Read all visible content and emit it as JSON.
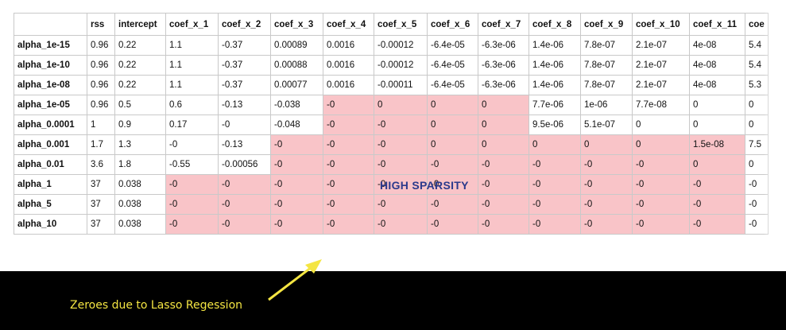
{
  "table": {
    "columns": [
      "",
      "rss",
      "intercept",
      "coef_x_1",
      "coef_x_2",
      "coef_x_3",
      "coef_x_4",
      "coef_x_5",
      "coef_x_6",
      "coef_x_7",
      "coef_x_8",
      "coef_x_9",
      "coef_x_10",
      "coef_x_11",
      "coe"
    ],
    "rows": [
      {
        "label": "alpha_1e-15",
        "cells": [
          "0.96",
          "0.22",
          "1.1",
          "-0.37",
          "0.00089",
          "0.0016",
          "-0.00012",
          "-6.4e-05",
          "-6.3e-06",
          "1.4e-06",
          "7.8e-07",
          "2.1e-07",
          "4e-08",
          "5.4"
        ]
      },
      {
        "label": "alpha_1e-10",
        "cells": [
          "0.96",
          "0.22",
          "1.1",
          "-0.37",
          "0.00088",
          "0.0016",
          "-0.00012",
          "-6.4e-05",
          "-6.3e-06",
          "1.4e-06",
          "7.8e-07",
          "2.1e-07",
          "4e-08",
          "5.4"
        ]
      },
      {
        "label": "alpha_1e-08",
        "cells": [
          "0.96",
          "0.22",
          "1.1",
          "-0.37",
          "0.00077",
          "0.0016",
          "-0.00011",
          "-6.4e-05",
          "-6.3e-06",
          "1.4e-06",
          "7.8e-07",
          "2.1e-07",
          "4e-08",
          "5.3"
        ]
      },
      {
        "label": "alpha_1e-05",
        "cells": [
          "0.96",
          "0.5",
          "0.6",
          "-0.13",
          "-0.038",
          "-0",
          "0",
          "0",
          "0",
          "7.7e-06",
          "1e-06",
          "7.7e-08",
          "0",
          "0"
        ]
      },
      {
        "label": "alpha_0.0001",
        "cells": [
          "1",
          "0.9",
          "0.17",
          "-0",
          "-0.048",
          "-0",
          "-0",
          "0",
          "0",
          "9.5e-06",
          "5.1e-07",
          "0",
          "0",
          "0"
        ]
      },
      {
        "label": "alpha_0.001",
        "cells": [
          "1.7",
          "1.3",
          "-0",
          "-0.13",
          "-0",
          "-0",
          "-0",
          "0",
          "0",
          "0",
          "0",
          "0",
          "1.5e-08",
          "7.5"
        ]
      },
      {
        "label": "alpha_0.01",
        "cells": [
          "3.6",
          "1.8",
          "-0.55",
          "-0.00056",
          "-0",
          "-0",
          "-0",
          "-0",
          "-0",
          "-0",
          "-0",
          "-0",
          "0",
          "0"
        ]
      },
      {
        "label": "alpha_1",
        "cells": [
          "37",
          "0.038",
          "-0",
          "-0",
          "-0",
          "-0",
          "-0",
          "-0",
          "-0",
          "-0",
          "-0",
          "-0",
          "-0",
          "-0"
        ]
      },
      {
        "label": "alpha_5",
        "cells": [
          "37",
          "0.038",
          "-0",
          "-0",
          "-0",
          "-0",
          "-0",
          "-0",
          "-0",
          "-0",
          "-0",
          "-0",
          "-0",
          "-0"
        ]
      },
      {
        "label": "alpha_10",
        "cells": [
          "37",
          "0.038",
          "-0",
          "-0",
          "-0",
          "-0",
          "-0",
          "-0",
          "-0",
          "-0",
          "-0",
          "-0",
          "-0",
          "-0"
        ]
      }
    ],
    "highlight_color": "#f9c4c8"
  },
  "overlay_label": "HIGH SPARSITY",
  "annotation": {
    "text": "Zeroes due to Lasso Regession",
    "color": "#f4e542"
  }
}
